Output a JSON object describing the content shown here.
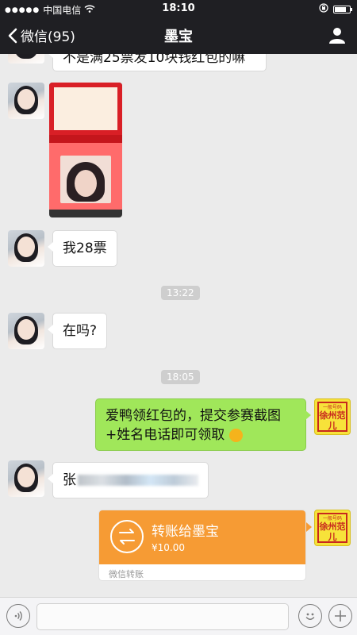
{
  "status_bar": {
    "carrier": "中国电信",
    "time": "18:10",
    "battery_level": 0.75
  },
  "nav": {
    "back_label": "微信(95)",
    "title": "墨宝"
  },
  "messages": {
    "m0_text": "不是满25票发10块钱红包的嘛",
    "m2_text": "我28票",
    "time1": "13:22",
    "m3_text": "在吗?",
    "time2": "18:05",
    "m4_text": "爱鸭领红包的，提交参赛截图+姓名电话即可领取",
    "m5_text": "张",
    "self_avatar_sub": "一般号码",
    "self_avatar_big": "徐州范儿"
  },
  "transfer": {
    "title": "转账给墨宝",
    "amount": "¥10.00",
    "footer": "微信转账"
  },
  "colors": {
    "nav_bg": "#1f1f23",
    "chat_bg": "#ebebeb",
    "self_bubble": "#a0e75a",
    "transfer_orange": "#f69b34"
  }
}
